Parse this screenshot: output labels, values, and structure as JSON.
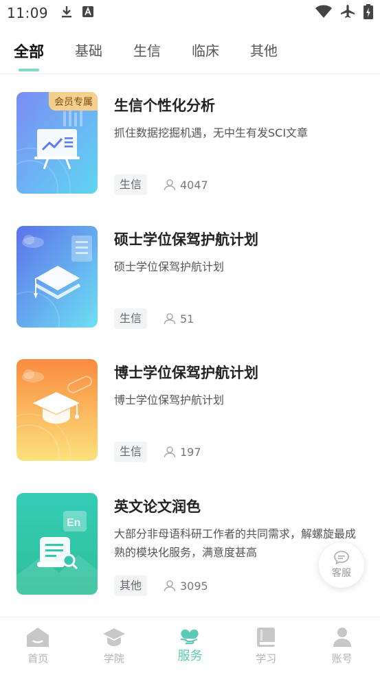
{
  "status_bar": {
    "time": "11:09",
    "icons_left": [
      "download-icon",
      "font-a-icon"
    ],
    "icons_right": [
      "wifi-icon",
      "airplane-mode-icon",
      "battery-charging-icon"
    ]
  },
  "tabs": [
    {
      "label": "全部",
      "active": true
    },
    {
      "label": "基础",
      "active": false
    },
    {
      "label": "生信",
      "active": false
    },
    {
      "label": "临床",
      "active": false
    },
    {
      "label": "其他",
      "active": false
    }
  ],
  "courses": [
    {
      "title": "生信个性化分析",
      "desc": "抓住数据挖掘机遇，无中生有发SCI文章",
      "tag": "生信",
      "count": "4047",
      "badge": "会员专属",
      "icon": "presentation-chart-icon"
    },
    {
      "title": "硕士学位保驾护航计划",
      "desc": "硕士学位保驾护航计划",
      "tag": "生信",
      "count": "51",
      "badge": "",
      "icon": "layers-icon"
    },
    {
      "title": "博士学位保驾护航计划",
      "desc": "博士学位保驾护航计划",
      "tag": "生信",
      "count": "197",
      "badge": "",
      "icon": "graduation-cap-icon"
    },
    {
      "title": "英文论文润色",
      "desc": "大部分非母语科研工作者的共同需求，解螺旋最成熟的模块化服务，满意度甚高",
      "tag": "其他",
      "count": "3095",
      "badge": "",
      "icon": "document-search-icon"
    }
  ],
  "service_fab": {
    "label": "客服",
    "icon": "chat-bubble-icon"
  },
  "bottom_nav": [
    {
      "label": "首页",
      "icon": "home-icon",
      "active": false
    },
    {
      "label": "学院",
      "icon": "college-cap-icon",
      "active": false
    },
    {
      "label": "服务",
      "icon": "service-heart-icon",
      "active": true
    },
    {
      "label": "学习",
      "icon": "book-icon",
      "active": false
    },
    {
      "label": "账号",
      "icon": "person-icon",
      "active": false
    }
  ],
  "colors": {
    "accent": "#5cc9b4",
    "tab_indicator": "#7fd8c8",
    "badge_bg": "#f7cf8d",
    "nav_inactive": "#c7c7c7"
  }
}
